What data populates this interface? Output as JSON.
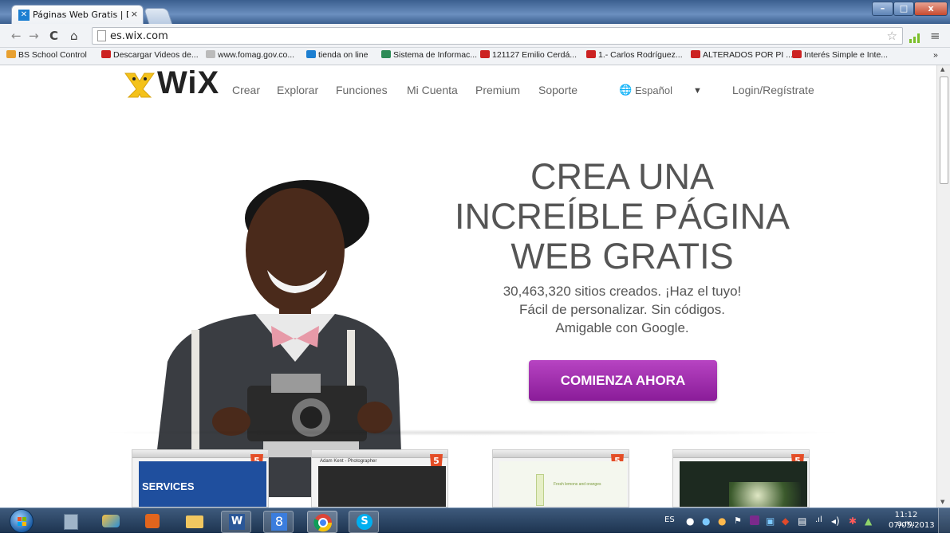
{
  "browser": {
    "tab_title": "Páginas Web Gratis | Desc",
    "tab_close": "×",
    "url": "es.wix.com",
    "window_buttons": {
      "min": "–",
      "max": "□",
      "close": "x"
    }
  },
  "bookmarks": [
    {
      "label": "BS School Control",
      "color": "#e8a030"
    },
    {
      "label": "Descargar Videos de...",
      "color": "#cc2222"
    },
    {
      "label": "www.fomag.gov.co...",
      "color": "#888888"
    },
    {
      "label": "tienda on line",
      "color": "#1d7fd1"
    },
    {
      "label": "Sistema de Informac...",
      "color": "#2e8b57"
    },
    {
      "label": "121127 Emilio Cerdá...",
      "color": "#cc2222"
    },
    {
      "label": "1.- Carlos Rodríguez...",
      "color": "#cc2222"
    },
    {
      "label": "ALTERADOS POR PI ...",
      "color": "#cc2222"
    },
    {
      "label": "Interés Simple e Inte...",
      "color": "#cc2222"
    }
  ],
  "bookmarks_overflow": "»",
  "site": {
    "logo_text": "WiX",
    "nav": [
      "Crear",
      "Explorar",
      "Funciones",
      "Mi Cuenta",
      "Premium",
      "Soporte"
    ],
    "language": "Español",
    "language_arrow": "▼",
    "login": "Login/Regístrate",
    "headline": [
      "CREA UNA",
      "INCREÍBLE PÁGINA",
      "WEB GRATIS"
    ],
    "sublines": [
      "30,463,320 sitios creados. ¡Haz el tuyo!",
      "Fácil de personalizar. Sin códigos.",
      "Amigable con Google."
    ],
    "cta": "COMIENZA AHORA",
    "html5_badge": "5",
    "thumbnails": [
      {
        "caption": "SERVICES",
        "bg": "#1f4f9e"
      },
      {
        "caption": "Adam Kent - Photographer",
        "bg": "#2a2a2a"
      },
      {
        "caption": "Fresh lemons and oranges",
        "bg": "#f4f7ee"
      },
      {
        "caption": "",
        "bg": "#1d2a20"
      }
    ]
  },
  "taskbar": {
    "lang": "ES",
    "time": "11:12 a.m.",
    "date": "07/05/2013",
    "colors": {
      "accent": "#7b2a8c",
      "brand_purple": "#9b2fae"
    }
  }
}
